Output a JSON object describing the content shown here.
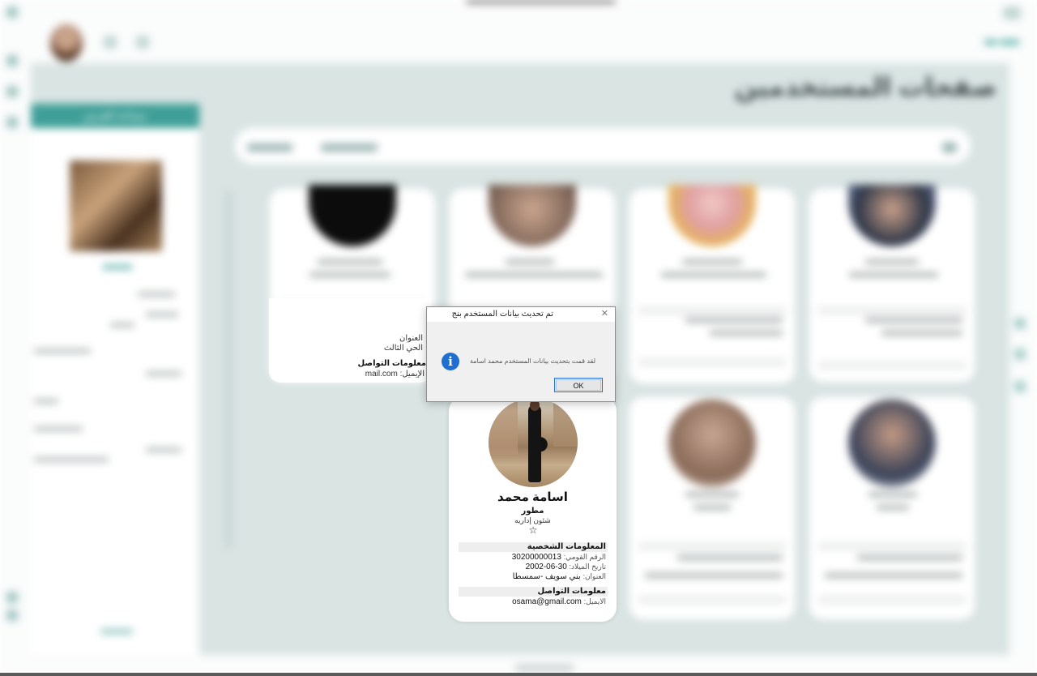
{
  "page": {
    "title": "صفحات المستخدمين"
  },
  "sidebar_header": "مساحة للعرض",
  "card_osama": {
    "name": "اسامة محمد",
    "role": "مطور",
    "department": "شئون إداريه",
    "star": "☆",
    "personal_section": "المعلومات الشخصية",
    "national_id_label": "الرقم القومي:",
    "national_id_value": "30200000013",
    "birth_label": "تاريخ الميلاد:",
    "birth_value": "30-06-2002",
    "address_label": "العنوان:",
    "address_value": "بني سويف -سمسطا",
    "contact_section": "معلومات التواصل",
    "email_label": "الايميل:",
    "email_value": "osama@gmail.com"
  },
  "card_behind": {
    "address_label": "العنوان",
    "district": "الحي الثالث",
    "contact_section": "معلومات التواصل",
    "email_label": "الإيميل:",
    "email_value": "mail.com"
  },
  "dialog": {
    "title": "تم تحديث بيانات المستخدم بنج",
    "message": "لقد قمت بتحديث بيانات المستخدم محمد اسامة",
    "icon": "info-icon",
    "icon_glyph": "i",
    "ok_label": "OK",
    "close_glyph": "✕"
  },
  "colors": {
    "accent": "#3f9f98",
    "panel": "#d9e4e3",
    "dialog_button_border": "#2c6fd4",
    "info_icon": "#1f6fd0"
  }
}
